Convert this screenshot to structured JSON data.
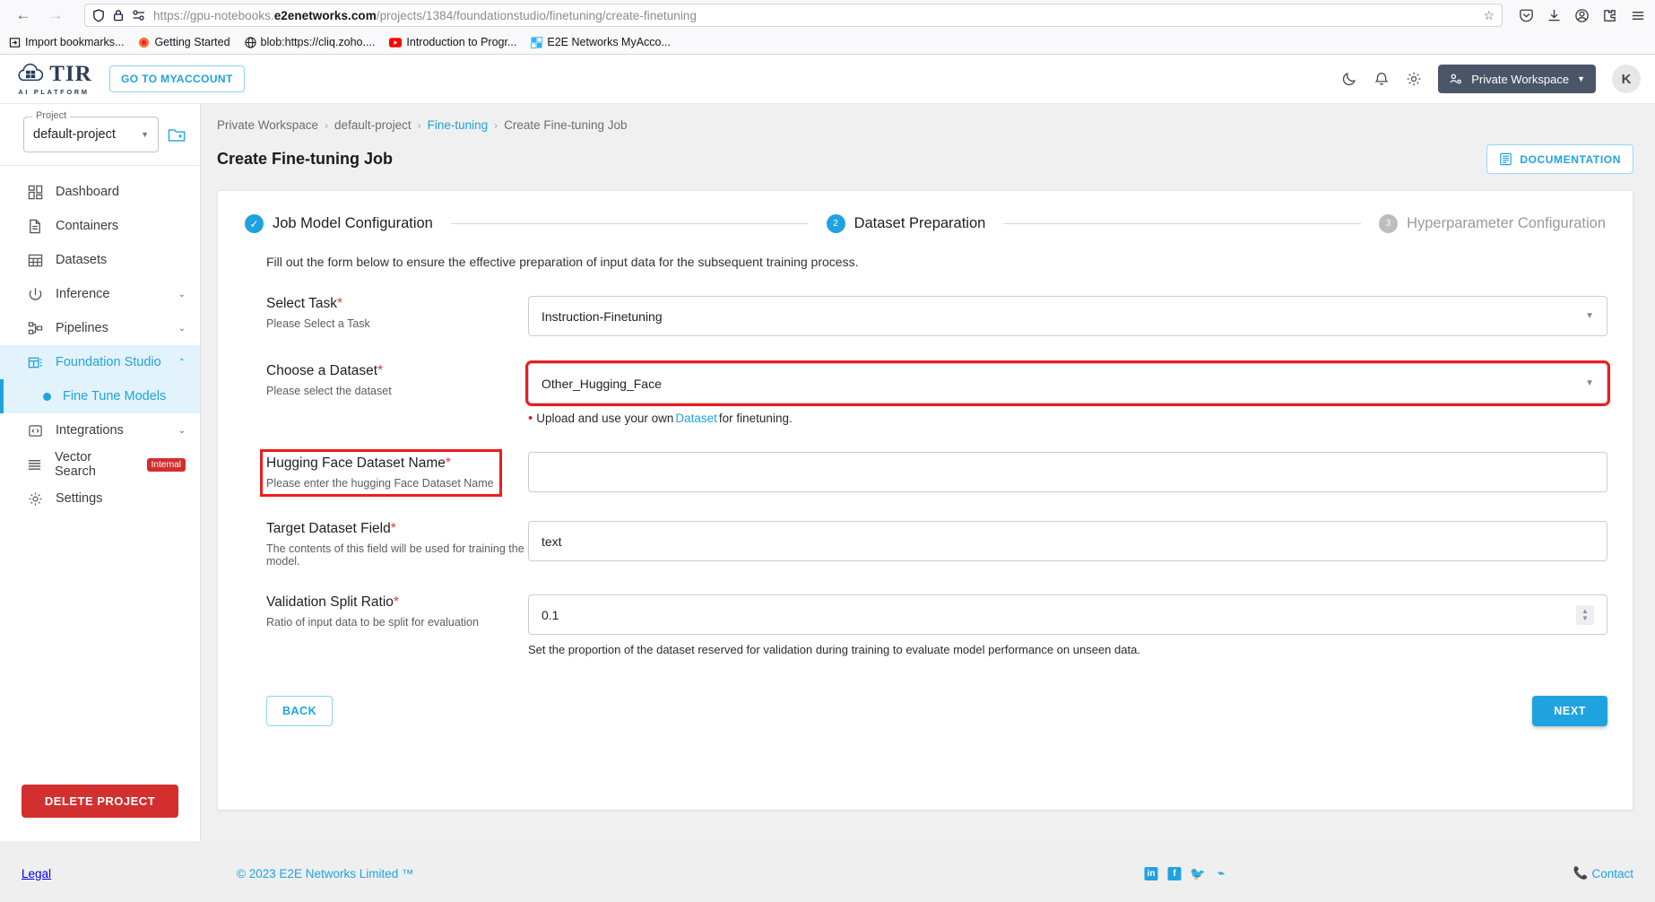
{
  "browser": {
    "back_icon": "back-arrow",
    "forward_icon": "forward-arrow",
    "url_prefix": "https://gpu-notebooks.",
    "url_domain": "e2enetworks.com",
    "url_path": "/projects/1384/foundationstudio/finetuning/create-finetuning",
    "bookmarks": [
      {
        "label": "Import bookmarks...",
        "icon": "import-icon"
      },
      {
        "label": "Getting Started",
        "icon": "firefox-icon"
      },
      {
        "label": "blob:https://cliq.zoho....",
        "icon": "globe-icon"
      },
      {
        "label": "Introduction to Progr...",
        "icon": "youtube-icon"
      },
      {
        "label": "E2E Networks MyAcco...",
        "icon": "e2e-icon"
      }
    ]
  },
  "header": {
    "logo_text": "TIR",
    "logo_subtitle": "AI PLATFORM",
    "myaccount_label": "GO TO MYACCOUNT",
    "workspace_label": "Private Workspace",
    "avatar_initial": "K",
    "icons": [
      "dark-mode-icon",
      "notification-bell-icon",
      "gear-icon"
    ]
  },
  "sidebar": {
    "project_legend": "Project",
    "project_value": "default-project",
    "items": [
      {
        "label": "Dashboard",
        "icon": "dashboard-icon",
        "expandable": false,
        "active": false
      },
      {
        "label": "Containers",
        "icon": "document-icon",
        "expandable": false,
        "active": false
      },
      {
        "label": "Datasets",
        "icon": "grid-icon",
        "expandable": false,
        "active": false
      },
      {
        "label": "Inference",
        "icon": "inference-icon",
        "expandable": true,
        "active": false
      },
      {
        "label": "Pipelines",
        "icon": "pipelines-icon",
        "expandable": true,
        "active": false
      },
      {
        "label": "Foundation Studio",
        "icon": "foundation-studio-icon",
        "expandable": true,
        "active": true
      }
    ],
    "sub_item": {
      "label": "Fine Tune Models"
    },
    "items_after": [
      {
        "label": "Integrations",
        "icon": "code-brackets-icon",
        "expandable": true
      },
      {
        "label": "Vector Search",
        "icon": "list-icon",
        "expandable": false,
        "badge": "Internal"
      },
      {
        "label": "Settings",
        "icon": "gear-icon",
        "expandable": false
      }
    ],
    "delete_label": "DELETE PROJECT"
  },
  "breadcrumb": [
    {
      "label": "Private Workspace",
      "link": false
    },
    {
      "label": "default-project",
      "link": false
    },
    {
      "label": "Fine-tuning",
      "link": true
    },
    {
      "label": "Create Fine-tuning Job",
      "link": false
    }
  ],
  "page": {
    "title": "Create Fine-tuning Job",
    "documentation_label": "DOCUMENTATION"
  },
  "stepper": {
    "steps": [
      {
        "number": "✓",
        "label": "Job Model Configuration",
        "state": "done"
      },
      {
        "number": "2",
        "label": "Dataset Preparation",
        "state": "active"
      },
      {
        "number": "3",
        "label": "Hyperparameter Configuration",
        "state": "idle"
      }
    ]
  },
  "form": {
    "intro": "Fill out the form below to ensure the effective preparation of input data for the subsequent training process.",
    "fields": [
      {
        "title": "Select Task",
        "required": "*",
        "sub": "Please Select a Task",
        "value": "Instruction-Finetuning",
        "control": "select",
        "highlight_control": false,
        "highlight_label": false
      },
      {
        "title": "Choose a Dataset",
        "required": "*",
        "sub": "Please select the dataset",
        "value": "Other_Hugging_Face",
        "control": "select",
        "highlight_control": true,
        "highlight_label": false,
        "hint_pre": "Upload and use your own ",
        "hint_link": "Dataset",
        "hint_post": " for finetuning."
      },
      {
        "title": "Hugging Face Dataset Name",
        "required": "*",
        "sub": "Please enter the hugging Face Dataset Name",
        "value": "",
        "placeholder": "",
        "control": "text",
        "highlight_control": false,
        "highlight_label": true
      },
      {
        "title": "Target Dataset Field",
        "required": "*",
        "sub": "The contents of this field will be used for training the model.",
        "value": "text",
        "control": "text",
        "highlight_control": false,
        "highlight_label": false
      },
      {
        "title": "Validation Split Ratio",
        "required": "*",
        "sub": "Ratio of input data to be split for evaluation",
        "value": "0.1",
        "control": "number",
        "highlight_control": false,
        "highlight_label": false,
        "subhint": "Set the proportion of the dataset reserved for validation during training to evaluate model performance on unseen data."
      }
    ],
    "back_label": "BACK",
    "next_label": "NEXT"
  },
  "footer": {
    "legal": "Legal",
    "copyright": "© 2023 E2E Networks Limited ™",
    "contact": "Contact",
    "social": [
      "linkedin-icon",
      "facebook-icon",
      "twitter-icon",
      "rss-icon"
    ]
  },
  "colors": {
    "accent": "#1fa3e0",
    "danger": "#d32f2f",
    "highlight": "#ee1c1c",
    "workspace_chip": "#4a5568"
  }
}
